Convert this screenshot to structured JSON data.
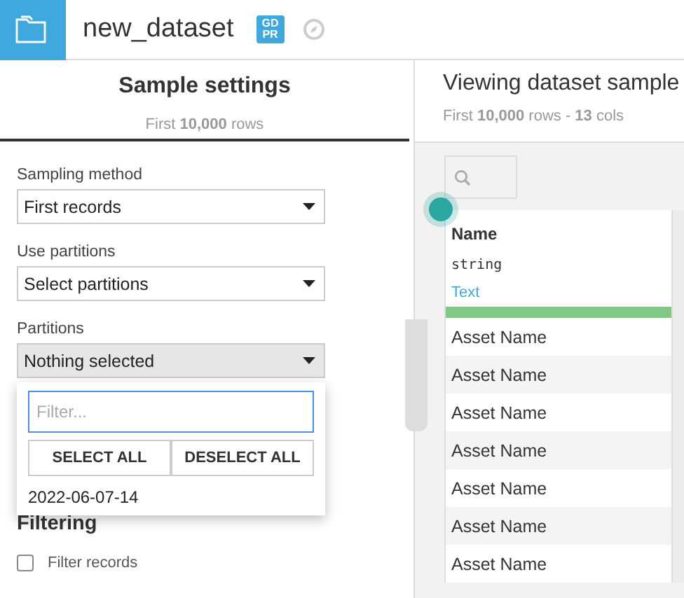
{
  "header": {
    "title": "new_dataset",
    "badge": "GD PR"
  },
  "sample_settings": {
    "title": "Sample settings",
    "subtitle": "First **10,000** rows",
    "fields": [
      {
        "label": "Sampling method",
        "value": "First records",
        "kind": "select"
      },
      {
        "label": "Use partitions",
        "value": "Select partitions",
        "kind": "select"
      },
      {
        "label": "Partitions",
        "value": "Nothing selected",
        "kind": "multiselect",
        "expanded": true
      }
    ],
    "partition_menu": {
      "placeholder": "Filter...",
      "buttons": [
        "SELECT ALL",
        "DESELECT ALL"
      ],
      "items": [
        "2022-06-07-14"
      ]
    },
    "filtering": {
      "title": "Filtering",
      "checkbox": {
        "label": "Filter records",
        "checked": false
      }
    }
  },
  "viewer": {
    "title": "Viewing dataset sample",
    "subtitle": "First **10,000** rows - **13** cols",
    "columns": [
      {
        "name": "Name",
        "type": "string",
        "meaning": "Text"
      }
    ],
    "rows": [
      [
        "Asset Name"
      ],
      [
        "Asset Name"
      ],
      [
        "Asset Name"
      ],
      [
        "Asset Name"
      ],
      [
        "Asset Name"
      ],
      [
        "Asset Name"
      ],
      [
        "Asset Name"
      ]
    ]
  }
}
